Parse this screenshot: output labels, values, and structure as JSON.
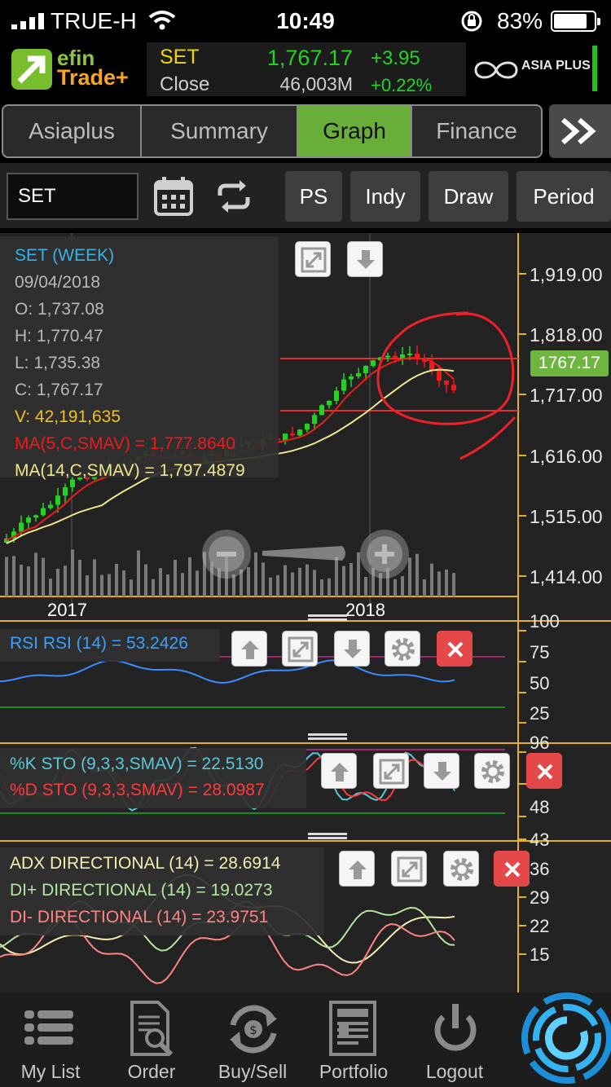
{
  "status_bar": {
    "carrier": "TRUE-H",
    "time": "10:49",
    "battery_pct": "83%",
    "battery_level": 0.83
  },
  "header": {
    "logo_efin": "efin",
    "logo_trade": "Trade+",
    "symbol": "SET",
    "close_label": "Close",
    "price": "1,767.17",
    "change": "+3.95",
    "volume": "46,003M",
    "change_pct": "+0.22%",
    "brand": "ASIA PLUS"
  },
  "tabs": [
    {
      "label": "Asiaplus",
      "active": false
    },
    {
      "label": "Summary",
      "active": false
    },
    {
      "label": "Graph",
      "active": true
    },
    {
      "label": "Finance",
      "active": false
    }
  ],
  "toolbar": {
    "symbol_value": "SET",
    "ps": "PS",
    "indy": "Indy",
    "draw": "Draw",
    "period": "Period"
  },
  "main_chart": {
    "info": {
      "title": "SET (WEEK)",
      "date": "09/04/2018",
      "open": "O: 1,737.08",
      "high": "H: 1,770.47",
      "low": "L: 1,735.38",
      "close": "C: 1,767.17",
      "volume": "V: 42,191,635",
      "ma5": "MA(5,C,SMAV) = 1,777.8640",
      "ma14": "MA(14,C,SMAV) = 1,797.4879"
    },
    "y_labels": [
      "1,919.00",
      "1,818.00",
      "1,717.00",
      "1,616.00",
      "1,515.00",
      "1,414.00"
    ],
    "last_price_tag": "1767.17",
    "x_labels": [
      "2017",
      "2018"
    ]
  },
  "rsi": {
    "label": "RSI RSI (14) = 53.2426",
    "y_labels": [
      "100",
      "75",
      "50",
      "25"
    ]
  },
  "sto": {
    "k_label": "%K STO (9,3,3,SMAV) = 22.5130",
    "d_label": "%D STO (9,3,3,SMAV) = 28.0987",
    "y_labels": [
      "96",
      "72",
      "48"
    ]
  },
  "adx": {
    "adx_label": "ADX DIRECTIONAL (14) = 28.6914",
    "dip_label": "DI+ DIRECTIONAL (14) = 19.0273",
    "dim_label": "DI- DIRECTIONAL (14) = 23.9751",
    "y_labels": [
      "43",
      "36",
      "29",
      "22",
      "15"
    ]
  },
  "bottom_nav": [
    {
      "label": "My List"
    },
    {
      "label": "Order"
    },
    {
      "label": "Buy/Sell"
    },
    {
      "label": "Portfolio"
    },
    {
      "label": "Logout"
    }
  ],
  "colors": {
    "accent_green": "#6aae3a",
    "up": "#20d420",
    "down": "#f01a1a"
  },
  "icons": [
    "signal-icon",
    "wifi-icon",
    "rotation-lock-icon",
    "battery-icon",
    "calendar-icon",
    "refresh-icon",
    "expand-icon",
    "arrow-up-icon",
    "arrow-down-icon",
    "gear-icon",
    "close-icon",
    "zoom-out-icon",
    "zoom-in-icon",
    "list-icon",
    "order-icon",
    "buy-sell-icon",
    "portfolio-icon",
    "logout-icon",
    "spinner-icon"
  ]
}
